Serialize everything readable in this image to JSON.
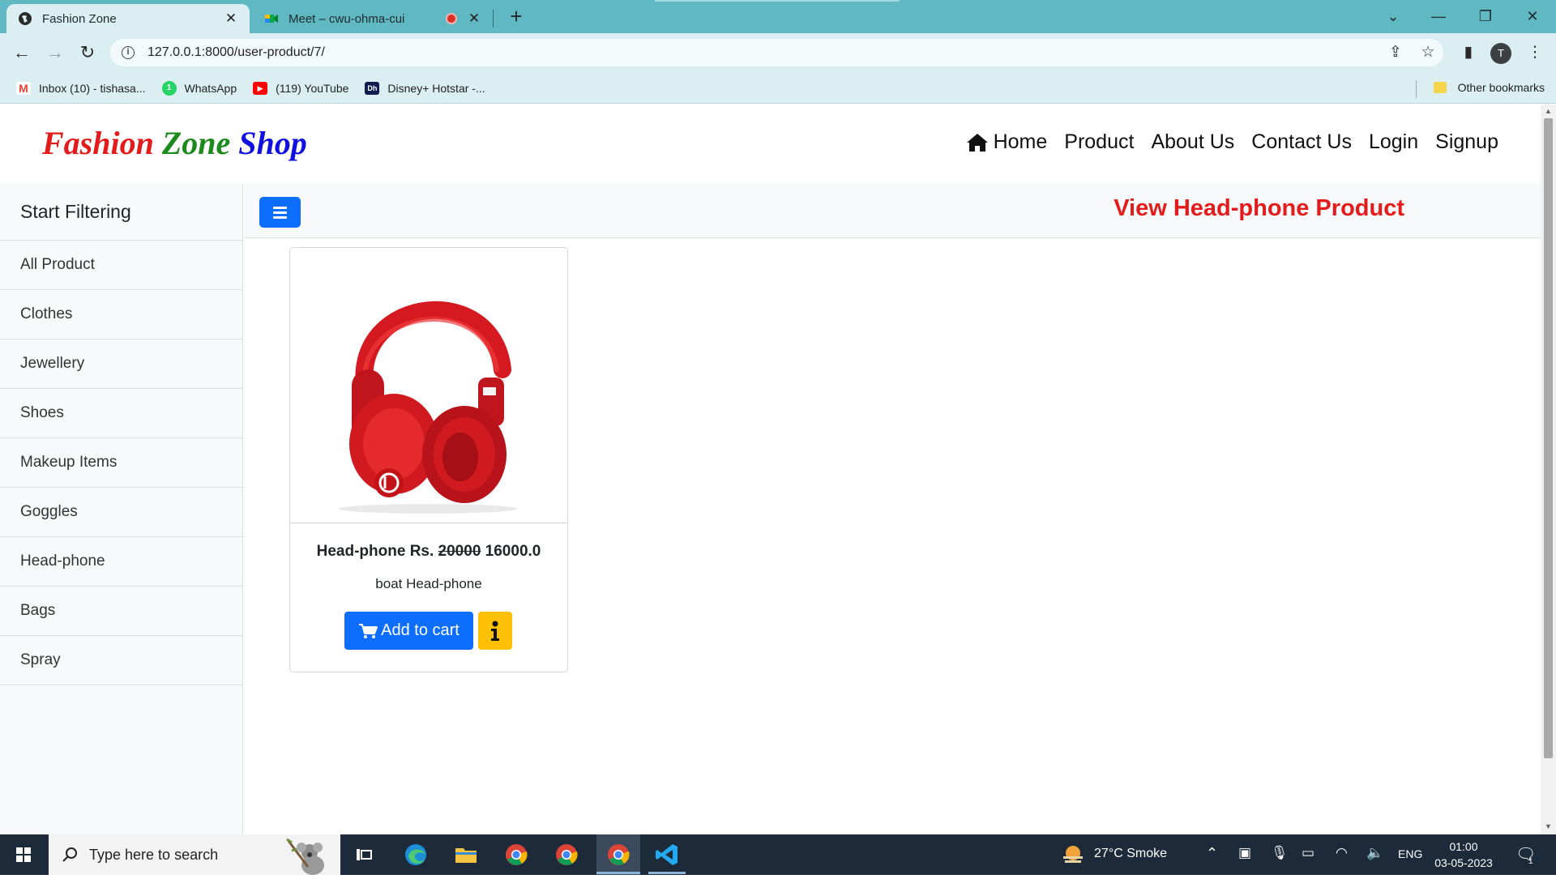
{
  "browser": {
    "tabs": [
      {
        "title": "Fashion Zone",
        "active": true
      },
      {
        "title": "Meet – cwu-ohma-cui",
        "active": false
      }
    ],
    "new_tab": "+",
    "url": "127.0.0.1:8000/user-product/7/",
    "profile_initial": "T",
    "bookmarks": [
      {
        "label": "Inbox (10) - tishasa...",
        "icon": "gmail-icon"
      },
      {
        "label": "WhatsApp",
        "icon": "whatsapp-icon"
      },
      {
        "label": "(119) YouTube",
        "icon": "youtube-icon"
      },
      {
        "label": "Disney+ Hotstar -...",
        "icon": "hotstar-icon"
      }
    ],
    "other_bookmarks": "Other bookmarks"
  },
  "site": {
    "brand": {
      "word1": "Fashion",
      "word2": "Zone",
      "word3": "Shop"
    },
    "nav": {
      "home": "Home",
      "product": "Product",
      "about": "About Us",
      "contact": "Contact Us",
      "login": "Login",
      "signup": "Signup"
    }
  },
  "sidebar": {
    "heading": "Start Filtering",
    "items": [
      "All Product",
      "Clothes",
      "Jewellery",
      "Shoes",
      "Makeup Items",
      "Goggles",
      "Head-phone",
      "Bags",
      "Spray"
    ]
  },
  "content": {
    "heading": "View Head-phone Product"
  },
  "product": {
    "name": "Head-phone",
    "currency": "Rs.",
    "original_price": "20000",
    "price": "16000.0",
    "description": "boat Head-phone",
    "cart_label": "Add to cart",
    "info_icon": "info-icon"
  },
  "taskbar": {
    "search_placeholder": "Type here to search",
    "weather": "27°C  Smoke",
    "language": "ENG",
    "time": "01:00",
    "date": "03-05-2023",
    "notification_count": "1"
  },
  "colors": {
    "brand_red": "#e31b1b",
    "brand_green": "#1c8a1c",
    "brand_blue": "#1010e0",
    "primary": "#0d6efd",
    "warning": "#ffc107",
    "tab_bar": "#5fb8c2"
  }
}
